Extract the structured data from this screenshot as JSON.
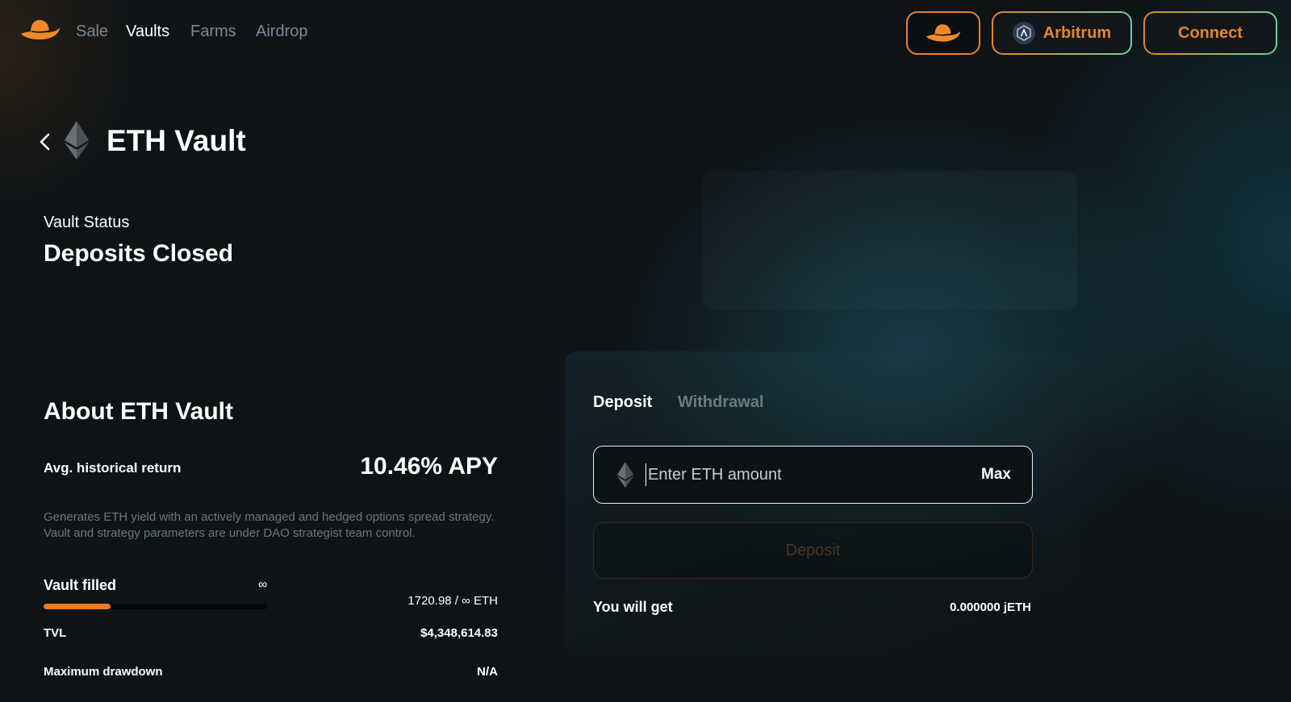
{
  "nav": {
    "links": [
      {
        "label": "Sale",
        "active": false
      },
      {
        "label": "Vaults",
        "active": true
      },
      {
        "label": "Farms",
        "active": false
      },
      {
        "label": "Airdrop",
        "active": false
      }
    ],
    "network_label": "Arbitrum",
    "connect_label": "Connect",
    "logo_icon": "hat-logo-icon",
    "accent_color": "#e7832d"
  },
  "header": {
    "title": "ETH Vault",
    "back_icon": "chevron-left-icon",
    "token_icon": "ethereum-icon"
  },
  "status": {
    "label": "Vault Status",
    "value": "Deposits Closed"
  },
  "about": {
    "title": "About ETH Vault",
    "apy_label": "Avg. historical return",
    "apy_value": "10.46% APY",
    "description": "Generates ETH yield with an actively managed and hedged options spread strategy. Vault and strategy parameters are under DAO strategist team control.",
    "filled_label": "Vault filled",
    "filled_cap_symbol": "∞",
    "filled_amount": "1720.98 / ∞ ETH",
    "filled_fraction": 0.3,
    "tvl_label": "TVL",
    "tvl_value": "$4,348,614.83",
    "drawdown_label": "Maximum drawdown",
    "drawdown_value": "N/A"
  },
  "form": {
    "tabs": [
      {
        "label": "Deposit",
        "active": true
      },
      {
        "label": "Withdrawal",
        "active": false
      }
    ],
    "amount_placeholder": "Enter ETH amount",
    "amount_value": "",
    "max_label": "Max",
    "deposit_label": "Deposit",
    "receive_label": "You will get",
    "receive_value": "0.000000 jETH"
  }
}
